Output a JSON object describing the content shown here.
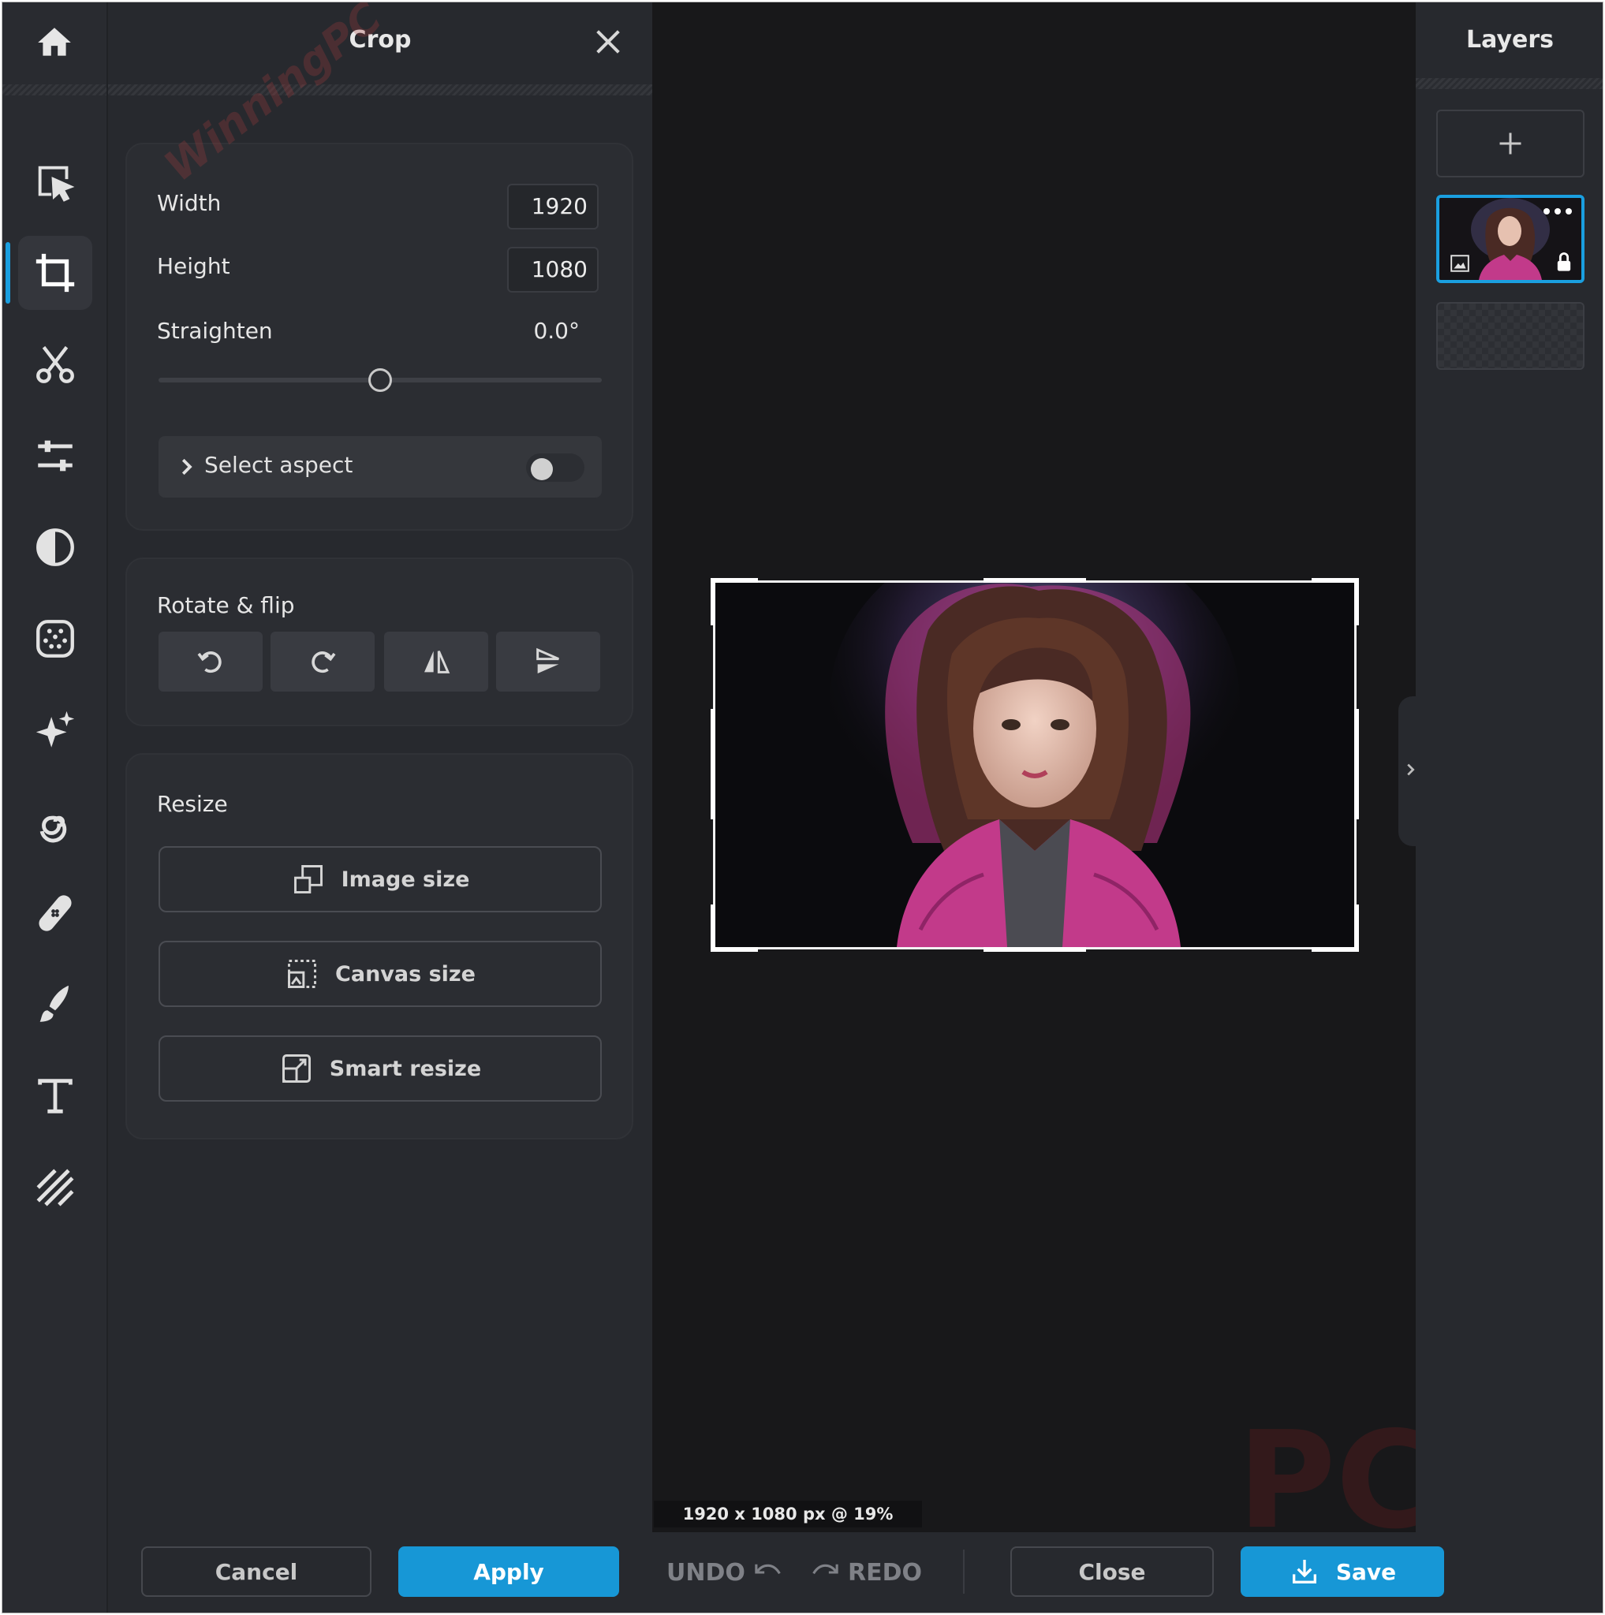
{
  "crop_panel": {
    "title": "Crop",
    "width_label": "Width",
    "width_value": "1920",
    "height_label": "Height",
    "height_value": "1080",
    "straighten_label": "Straighten",
    "straighten_value": "0.0°",
    "straighten_level": 0.5,
    "select_aspect_label": "Select aspect",
    "aspect_toggle_on": false,
    "rotate_flip_title": "Rotate & flip",
    "rotate_flip_buttons": [
      "rotate-left-icon",
      "rotate-right-icon",
      "flip-horizontal-icon",
      "flip-vertical-icon"
    ],
    "resize_title": "Resize",
    "image_size_label": "Image size",
    "canvas_size_label": "Canvas size",
    "smart_resize_label": "Smart resize"
  },
  "toolbar": {
    "home_icon": "home-icon",
    "tools": [
      "arrange-icon",
      "crop-icon",
      "cutout-icon",
      "adjust-icon",
      "filter-icon",
      "effects-icon",
      "ai-tools-icon",
      "liquify-icon",
      "retouch-icon",
      "draw-icon",
      "text-icon",
      "texture-icon"
    ],
    "active_tool": "crop"
  },
  "canvas": {
    "size_readout": "1920 x 1080 px @ 19%"
  },
  "layers": {
    "title": "Layers",
    "add_icon": "plus-icon"
  },
  "footer": {
    "cancel": "Cancel",
    "apply": "Apply",
    "undo": "UNDO",
    "redo": "REDO",
    "close": "Close",
    "save": "Save"
  },
  "watermark": {
    "diagonal": "WinningPC",
    "corner": "PC"
  },
  "colors": {
    "accent": "#1797d6",
    "panel_bg": "#27292e",
    "canvas_bg": "#18181a",
    "jacket": "#c23a8a"
  }
}
